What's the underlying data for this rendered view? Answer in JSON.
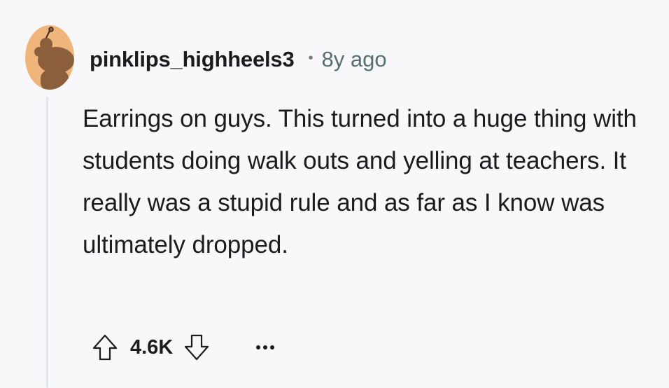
{
  "comment": {
    "username": "pinklips_highheels3",
    "separator": "•",
    "timestamp": "8y ago",
    "body": "Earrings on guys. This turned into a huge thing with students doing walk outs and yelling at teachers. It really was a stupid rule and as far as I know was ultimately dropped.",
    "score": "4.6K",
    "avatar_color": "#f0b57a"
  },
  "icons": {
    "upvote": "arrow-up-icon",
    "downvote": "arrow-down-icon",
    "more": "more-horizontal-icon"
  }
}
